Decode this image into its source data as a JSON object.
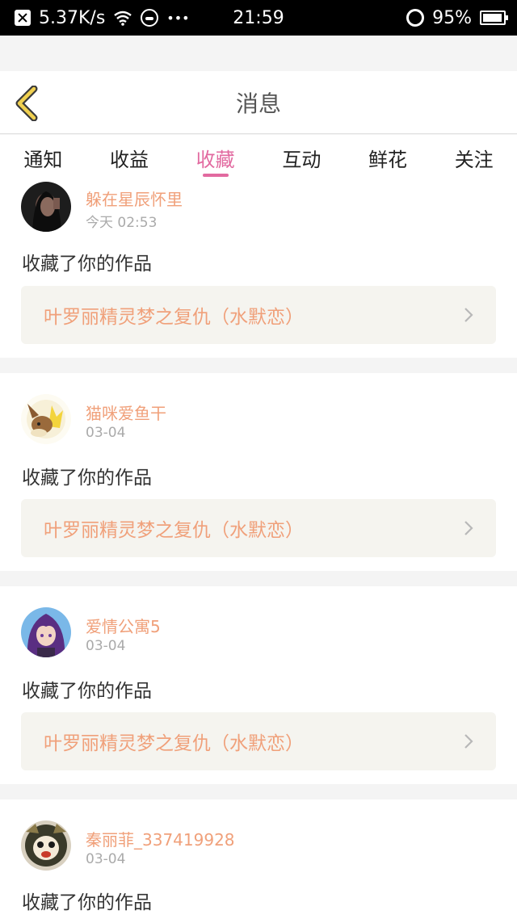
{
  "status_bar": {
    "net_speed": "5.37K/s",
    "time": "21:59",
    "battery": "95%",
    "battery_level": 0.95,
    "more": "•••"
  },
  "navbar": {
    "title": "消息",
    "back_icon": "chevron-left-icon",
    "accent_color": "#f0d050"
  },
  "tabs": [
    {
      "label": "通知",
      "active": false
    },
    {
      "label": "收益",
      "active": false
    },
    {
      "label": "收藏",
      "active": true
    },
    {
      "label": "互动",
      "active": false
    },
    {
      "label": "鲜花",
      "active": false
    },
    {
      "label": "关注",
      "active": false
    }
  ],
  "colors": {
    "active_tab": "#e26aa0",
    "username": "#f0a07a",
    "work_title": "#f0a07a",
    "work_box_bg": "#f5f4ef"
  },
  "messages": [
    {
      "user": "躲在星辰怀里",
      "time": "今天 02:53",
      "action": "收藏了你的作品",
      "work": "叶罗丽精灵梦之复仇（水默恋）"
    },
    {
      "user": "猫咪爱鱼干",
      "time": "03-04",
      "action": "收藏了你的作品",
      "work": "叶罗丽精灵梦之复仇（水默恋）"
    },
    {
      "user": "爱情公寓5",
      "time": "03-04",
      "action": "收藏了你的作品",
      "work": "叶罗丽精灵梦之复仇（水默恋）"
    },
    {
      "user": "秦丽菲_337419928",
      "time": "03-04",
      "action": "收藏了你的作品",
      "work": ""
    }
  ]
}
